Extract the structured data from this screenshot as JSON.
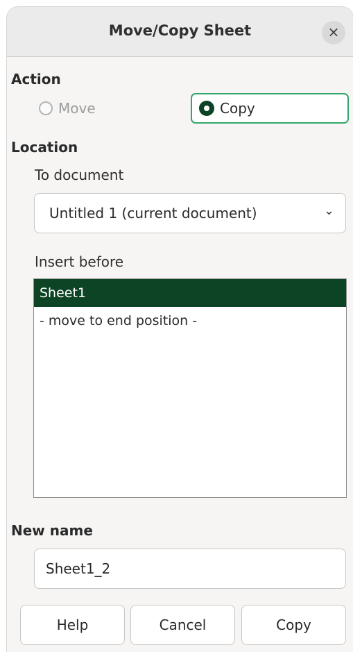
{
  "dialog": {
    "title": "Move/Copy Sheet",
    "close_glyph": "×"
  },
  "action": {
    "heading": "Action",
    "move_label": "Move",
    "copy_label": "Copy",
    "selected": "Copy",
    "move_enabled": false
  },
  "location": {
    "heading": "Location",
    "to_document_label": "To document",
    "document_value": "Untitled 1 (current document)",
    "insert_before_label": "Insert before",
    "items": [
      {
        "label": "Sheet1",
        "selected": true
      },
      {
        "label": "- move to end position -",
        "selected": false
      }
    ]
  },
  "new_name": {
    "heading": "New name",
    "value": "Sheet1_2"
  },
  "buttons": {
    "help": "Help",
    "cancel": "Cancel",
    "copy": "Copy"
  },
  "icons": {
    "close": "close-icon",
    "dropdown": "chevron-down-icon"
  },
  "colors": {
    "accent_green": "#33a66b",
    "selection_green": "#0d4425"
  }
}
